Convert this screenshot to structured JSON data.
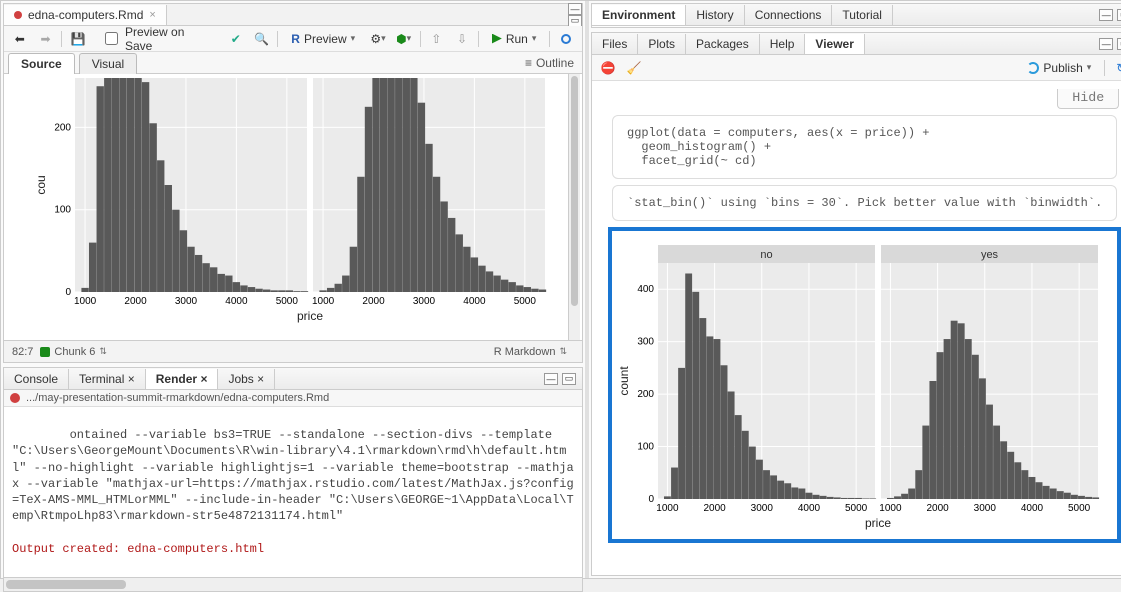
{
  "editor": {
    "file_tab": "edna-computers.Rmd",
    "toolbar": {
      "preview_on_save": "Preview on Save",
      "preview": "Preview",
      "run": "Run"
    },
    "modes": {
      "source": "Source",
      "visual": "Visual",
      "outline": "Outline"
    },
    "status": {
      "pos": "82:7",
      "chunk": "Chunk 6",
      "lang": "R Markdown"
    }
  },
  "bottom_tabs": {
    "console": "Console",
    "terminal": "Terminal",
    "render": "Render",
    "jobs": "Jobs"
  },
  "render": {
    "path": ".../may-presentation-summit-rmarkdown/edna-computers.Rmd",
    "log": "ontained --variable bs3=TRUE --standalone --section-divs --template \"C:\\Users\\GeorgeMount\\Documents\\R\\win-library\\4.1\\rmarkdown\\rmd\\h\\default.html\" --no-highlight --variable highlightjs=1 --variable theme=bootstrap --mathjax --variable \"mathjax-url=https://mathjax.rstudio.com/latest/MathJax.js?config=TeX-AMS-MML_HTMLorMML\" --include-in-header \"C:\\Users\\GEORGE~1\\AppData\\Local\\Temp\\RtmpoLhp83\\rmarkdown-str5e4872131174.html\"",
    "out": "Output created: edna-computers.html"
  },
  "env_tabs": {
    "environment": "Environment",
    "history": "History",
    "connections": "Connections",
    "tutorial": "Tutorial"
  },
  "viewer_tabs": {
    "files": "Files",
    "plots": "Plots",
    "packages": "Packages",
    "help": "Help",
    "viewer": "Viewer"
  },
  "viewer": {
    "publish": "Publish",
    "hide": "Hide",
    "code": "ggplot(data = computers, aes(x = price)) +\n  geom_histogram() +\n  facet_grid(~ cd)",
    "msg": "`stat_bin()` using `bins = 30`. Pick better value with `binwidth`."
  },
  "chart_data": {
    "type": "bar",
    "title": "",
    "xlabel": "price",
    "ylabel": "count",
    "xticks": [
      1000,
      2000,
      3000,
      4000,
      5000
    ],
    "facets": [
      {
        "name": "no",
        "yticks": [
          0,
          100,
          200,
          300,
          400
        ],
        "ylim": [
          0,
          450
        ],
        "bins": [
          {
            "x": 1000,
            "y": 5
          },
          {
            "x": 1150,
            "y": 60
          },
          {
            "x": 1300,
            "y": 250
          },
          {
            "x": 1450,
            "y": 430
          },
          {
            "x": 1600,
            "y": 395
          },
          {
            "x": 1750,
            "y": 345
          },
          {
            "x": 1900,
            "y": 310
          },
          {
            "x": 2050,
            "y": 305
          },
          {
            "x": 2200,
            "y": 255
          },
          {
            "x": 2350,
            "y": 205
          },
          {
            "x": 2500,
            "y": 160
          },
          {
            "x": 2650,
            "y": 130
          },
          {
            "x": 2800,
            "y": 100
          },
          {
            "x": 2950,
            "y": 75
          },
          {
            "x": 3100,
            "y": 55
          },
          {
            "x": 3250,
            "y": 45
          },
          {
            "x": 3400,
            "y": 35
          },
          {
            "x": 3550,
            "y": 30
          },
          {
            "x": 3700,
            "y": 22
          },
          {
            "x": 3850,
            "y": 20
          },
          {
            "x": 4000,
            "y": 12
          },
          {
            "x": 4150,
            "y": 8
          },
          {
            "x": 4300,
            "y": 6
          },
          {
            "x": 4450,
            "y": 4
          },
          {
            "x": 4600,
            "y": 3
          },
          {
            "x": 4750,
            "y": 2
          },
          {
            "x": 4900,
            "y": 2
          },
          {
            "x": 5050,
            "y": 2
          },
          {
            "x": 5200,
            "y": 1
          },
          {
            "x": 5350,
            "y": 1
          }
        ]
      },
      {
        "name": "yes",
        "yticks": [
          0,
          100,
          200,
          300,
          400
        ],
        "ylim": [
          0,
          450
        ],
        "bins": [
          {
            "x": 1000,
            "y": 2
          },
          {
            "x": 1150,
            "y": 5
          },
          {
            "x": 1300,
            "y": 10
          },
          {
            "x": 1450,
            "y": 20
          },
          {
            "x": 1600,
            "y": 55
          },
          {
            "x": 1750,
            "y": 140
          },
          {
            "x": 1900,
            "y": 225
          },
          {
            "x": 2050,
            "y": 280
          },
          {
            "x": 2200,
            "y": 305
          },
          {
            "x": 2350,
            "y": 340
          },
          {
            "x": 2500,
            "y": 335
          },
          {
            "x": 2650,
            "y": 305
          },
          {
            "x": 2800,
            "y": 275
          },
          {
            "x": 2950,
            "y": 230
          },
          {
            "x": 3100,
            "y": 180
          },
          {
            "x": 3250,
            "y": 140
          },
          {
            "x": 3400,
            "y": 110
          },
          {
            "x": 3550,
            "y": 90
          },
          {
            "x": 3700,
            "y": 70
          },
          {
            "x": 3850,
            "y": 55
          },
          {
            "x": 4000,
            "y": 42
          },
          {
            "x": 4150,
            "y": 32
          },
          {
            "x": 4300,
            "y": 25
          },
          {
            "x": 4450,
            "y": 20
          },
          {
            "x": 4600,
            "y": 15
          },
          {
            "x": 4750,
            "y": 12
          },
          {
            "x": 4900,
            "y": 8
          },
          {
            "x": 5050,
            "y": 6
          },
          {
            "x": 5200,
            "y": 4
          },
          {
            "x": 5350,
            "y": 3
          }
        ]
      }
    ]
  },
  "chart_data_editor": {
    "xlabel": "price",
    "ylabel": "cou",
    "xticks": [
      1000,
      2000,
      3000,
      4000,
      5000
    ],
    "yticks": [
      0,
      100,
      200
    ],
    "ylim": [
      0,
      260
    ]
  }
}
